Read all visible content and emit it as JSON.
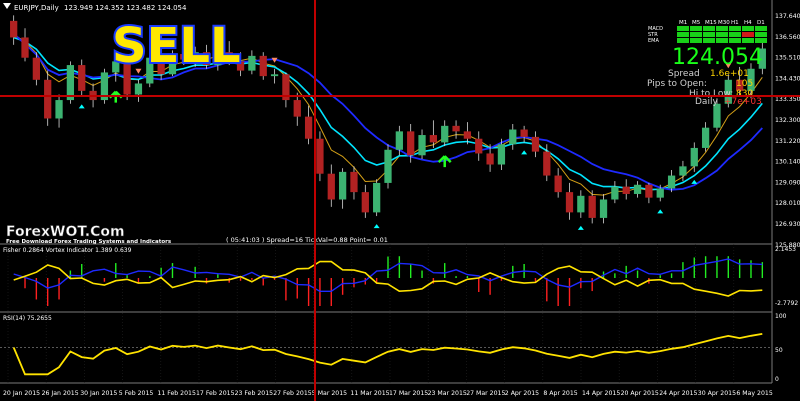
{
  "window": {
    "symbol_title": "EURJPY,Daily",
    "ohlc": "123.949 124.352 123.482 124.054"
  },
  "overlay": {
    "signal": "SELL",
    "brand": "ForexWOT.Com",
    "tagline": "Free Download Forex Trading Systems and Indicators",
    "timer_text": "( 05:41:03 )  Spread=16  TickVal=0.88  Point= 0.01"
  },
  "info_panel": {
    "timeframes": [
      "M1",
      "M5",
      "M15",
      "M30",
      "H1",
      "H4",
      "D1"
    ],
    "rows": [
      "MACD",
      "STR",
      "EMA"
    ],
    "bid": "124.054",
    "spread_label": "Spread",
    "spread_value": "1.6e+01",
    "pips_label": "Pips to Open:",
    "pips_value": "105",
    "hilo_label": "Hi to Low:",
    "hilo_value": "830",
    "daily_label": "Daily",
    "daily_value": "+7e+03"
  },
  "price_axis": {
    "labels": [
      "137.640",
      "136.560",
      "135.510",
      "134.430",
      "133.350",
      "132.300",
      "131.220",
      "130.140",
      "129.090",
      "128.010",
      "126.930",
      "125.880"
    ]
  },
  "fisher_panel": {
    "title": "Fisher 0.2864  Vortex Indicator 1.389 0.639",
    "axis_labels": [
      "2.1453",
      "-2.7792"
    ]
  },
  "rsi_panel": {
    "title": "RSI(14) 75.2655",
    "axis_labels": [
      "100",
      "50",
      "0"
    ]
  },
  "time_axis": {
    "labels": [
      "20 Jan 2015",
      "26 Jan 2015",
      "30 Jan 2015",
      "5 Feb 2015",
      "11 Feb 2015",
      "17 Feb 2015",
      "23 Feb 2015",
      "27 Feb 2015",
      "5 Mar 2015",
      "11 Mar 2015",
      "17 Mar 2015",
      "23 Mar 2015",
      "27 Mar 2015",
      "2 Apr 2015",
      "8 Apr 2015",
      "14 Apr 2015",
      "20 Apr 2015",
      "24 Apr 2015",
      "30 Apr 2015",
      "6 May 2015"
    ]
  },
  "colors": {
    "bull": "#3cb371",
    "bear": "#b22222",
    "ema_fast": "#00e5ff",
    "ema_slow": "#1e2aff",
    "ma_thin": "#d4a017",
    "yellow": "#ffe300",
    "crosshair": "#c00000",
    "sell_text": "#ffe800",
    "sell_outline": "#1a3cff"
  },
  "chart_data": {
    "type": "candlestick",
    "instrument": "EURJPY",
    "timeframe": "Daily",
    "candles": [
      [
        137.3,
        137.6,
        136.0,
        136.4
      ],
      [
        136.4,
        136.9,
        135.1,
        135.3
      ],
      [
        135.3,
        135.6,
        133.8,
        134.1
      ],
      [
        134.1,
        134.6,
        131.6,
        132.0
      ],
      [
        132.0,
        133.3,
        131.5,
        133.0
      ],
      [
        133.0,
        135.1,
        132.8,
        134.9
      ],
      [
        134.9,
        135.2,
        133.2,
        133.5
      ],
      [
        133.5,
        133.9,
        132.6,
        133.0
      ],
      [
        133.0,
        134.7,
        132.8,
        134.5
      ],
      [
        134.5,
        135.4,
        134.0,
        135.1
      ],
      [
        135.1,
        135.5,
        133.0,
        133.3
      ],
      [
        133.3,
        134.1,
        132.9,
        133.9
      ],
      [
        133.9,
        135.6,
        133.7,
        135.3
      ],
      [
        135.3,
        135.7,
        134.1,
        134.4
      ],
      [
        134.4,
        135.7,
        134.3,
        135.5
      ],
      [
        135.5,
        136.2,
        134.9,
        135.2
      ],
      [
        135.2,
        135.9,
        134.8,
        135.6
      ],
      [
        135.6,
        136.0,
        134.7,
        134.9
      ],
      [
        134.9,
        135.9,
        134.6,
        135.6
      ],
      [
        135.6,
        136.2,
        134.9,
        135.1
      ],
      [
        135.1,
        135.6,
        134.3,
        134.6
      ],
      [
        134.6,
        135.7,
        134.4,
        135.4
      ],
      [
        135.4,
        135.6,
        134.1,
        134.3
      ],
      [
        134.3,
        134.7,
        133.9,
        134.4
      ],
      [
        134.4,
        134.5,
        132.6,
        133.0
      ],
      [
        133.0,
        133.4,
        131.6,
        132.1
      ],
      [
        132.1,
        132.7,
        130.6,
        130.9
      ],
      [
        130.9,
        131.3,
        128.6,
        129.0
      ],
      [
        129.0,
        129.5,
        127.2,
        127.6
      ],
      [
        127.6,
        129.3,
        127.1,
        129.1
      ],
      [
        129.1,
        129.4,
        127.6,
        128.0
      ],
      [
        128.0,
        128.4,
        126.6,
        126.9
      ],
      [
        126.9,
        128.7,
        126.7,
        128.5
      ],
      [
        128.5,
        130.6,
        128.2,
        130.3
      ],
      [
        130.3,
        131.6,
        130.0,
        131.3
      ],
      [
        131.3,
        131.7,
        129.6,
        130.0
      ],
      [
        130.0,
        131.4,
        129.8,
        131.1
      ],
      [
        131.1,
        131.9,
        130.4,
        130.7
      ],
      [
        130.7,
        131.9,
        130.5,
        131.6
      ],
      [
        131.6,
        131.9,
        130.9,
        131.3
      ],
      [
        131.3,
        131.8,
        130.6,
        130.9
      ],
      [
        130.9,
        131.3,
        129.7,
        130.1
      ],
      [
        130.1,
        130.6,
        129.1,
        129.5
      ],
      [
        129.5,
        130.9,
        129.2,
        130.6
      ],
      [
        130.6,
        131.7,
        130.3,
        131.4
      ],
      [
        131.4,
        131.6,
        130.7,
        131.0
      ],
      [
        131.0,
        131.3,
        129.9,
        130.2
      ],
      [
        130.2,
        130.6,
        128.6,
        128.9
      ],
      [
        128.9,
        129.3,
        127.7,
        128.0
      ],
      [
        128.0,
        128.5,
        126.5,
        126.9
      ],
      [
        126.9,
        128.1,
        126.6,
        127.8
      ],
      [
        127.8,
        128.1,
        126.3,
        126.6
      ],
      [
        126.6,
        127.9,
        126.3,
        127.6
      ],
      [
        127.6,
        128.6,
        127.4,
        128.3
      ],
      [
        128.3,
        128.7,
        127.6,
        127.9
      ],
      [
        127.9,
        128.6,
        127.7,
        128.4
      ],
      [
        128.4,
        128.5,
        127.4,
        127.7
      ],
      [
        127.7,
        128.4,
        127.5,
        128.2
      ],
      [
        128.2,
        129.2,
        128.0,
        128.9
      ],
      [
        128.9,
        129.7,
        128.6,
        129.4
      ],
      [
        129.4,
        130.7,
        129.1,
        130.4
      ],
      [
        130.4,
        131.8,
        130.2,
        131.5
      ],
      [
        131.5,
        133.1,
        131.3,
        132.8
      ],
      [
        132.8,
        134.4,
        132.6,
        134.1
      ],
      [
        134.1,
        134.8,
        133.2,
        133.5
      ],
      [
        133.5,
        135.0,
        133.1,
        134.7
      ],
      [
        134.7,
        136.1,
        134.4,
        135.8
      ]
    ],
    "series": [
      {
        "name": "",
        "values": []
      }
    ],
    "price_range": [
      125.4,
      138.0
    ],
    "signals": {
      "sell_arrows": [
        11,
        23,
        63
      ],
      "buy_arrows_green": [
        9,
        38
      ],
      "buy_arrows_cyan": [
        6,
        32,
        45,
        50,
        57,
        60
      ]
    },
    "fisher_range": [
      -2.7792,
      2.1453
    ],
    "rsi_range": [
      0,
      100
    ],
    "rsi_levels": [
      50
    ]
  }
}
